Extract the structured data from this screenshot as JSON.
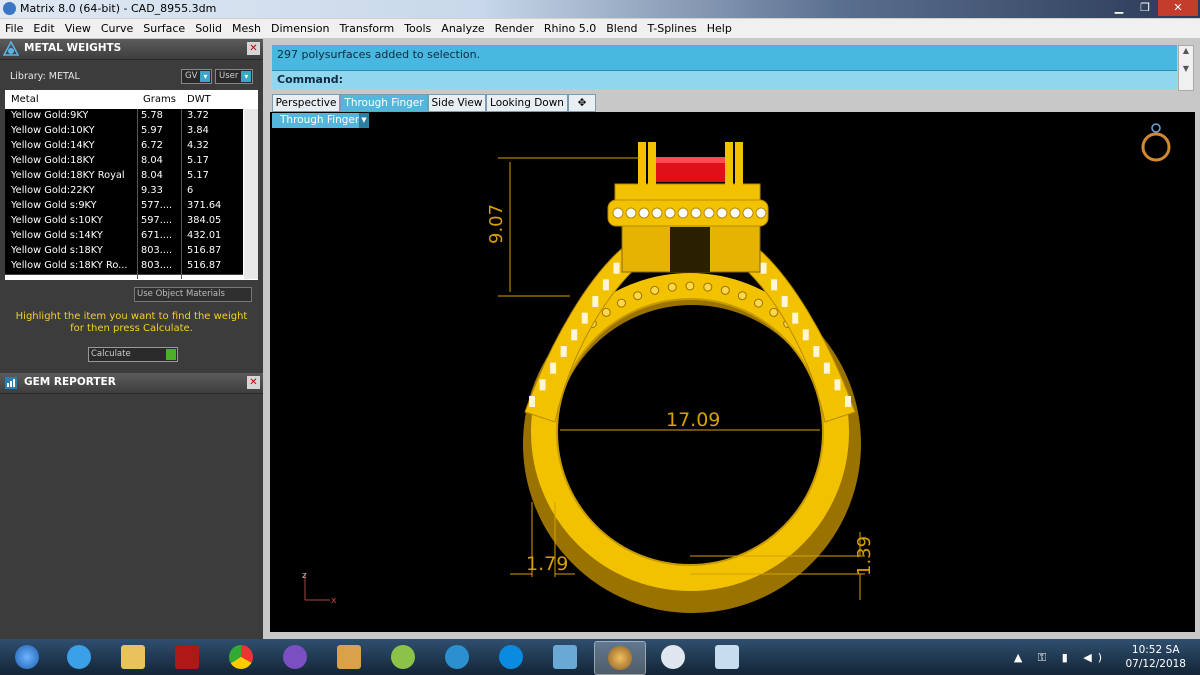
{
  "window": {
    "title": "Matrix 8.0 (64-bit) - CAD_8955.3dm",
    "min_glyph": "▁",
    "max_glyph": "❐",
    "close_glyph": "✕"
  },
  "menu": [
    "File",
    "Edit",
    "View",
    "Curve",
    "Surface",
    "Solid",
    "Mesh",
    "Dimension",
    "Transform",
    "Tools",
    "Analyze",
    "Render",
    "Rhino 5.0",
    "Blend",
    "T-Splines",
    "Help"
  ],
  "metal_weights": {
    "title": "METAL WEIGHTS",
    "library_label": "Library: METAL",
    "gv_label": "GV",
    "user_label": "User",
    "columns": [
      "Metal",
      "Grams",
      "DWT"
    ],
    "rows": [
      [
        "Yellow Gold:9KY",
        "5.78",
        "3.72"
      ],
      [
        "Yellow Gold:10KY",
        "5.97",
        "3.84"
      ],
      [
        "Yellow Gold:14KY",
        "6.72",
        "4.32"
      ],
      [
        "Yellow Gold:18KY",
        "8.04",
        "5.17"
      ],
      [
        "Yellow Gold:18KY Royal",
        "8.04",
        "5.17"
      ],
      [
        "Yellow Gold:22KY",
        "9.33",
        "6"
      ],
      [
        "Yellow Gold s:9KY",
        "577....",
        "371.64"
      ],
      [
        "Yellow Gold s:10KY",
        "597....",
        "384.05"
      ],
      [
        "Yellow Gold s:14KY",
        "671....",
        "432.01"
      ],
      [
        "Yellow Gold s:18KY",
        "803....",
        "516.87"
      ],
      [
        "Yellow Gold s:18KY Ro...",
        "803....",
        "516.87"
      ]
    ],
    "use_object_materials": "Use Object Materials",
    "hint": "Highlight the item you want to find the weight for then press Calculate.",
    "calculate_label": "Calculate"
  },
  "gem_reporter": {
    "title": "GEM REPORTER"
  },
  "command": {
    "history": "297 polysurfaces added to selection.",
    "prompt": "Command:"
  },
  "tabs": [
    "Perspective",
    "Through Finger",
    "Side View",
    "Looking Down",
    "✥"
  ],
  "active_tab": "Through Finger",
  "viewport": {
    "label": "Through Finger",
    "dimensions": {
      "height": "9.07",
      "inner_diameter": "17.09",
      "shank_width": "1.79",
      "shank_thickness": "1.39"
    },
    "axis_z": "z",
    "axis_x": "x",
    "colors": {
      "gold": "#f2c200",
      "gold_dark": "#b88a00",
      "stone": "#e0101a",
      "dim": "#d8a000"
    }
  },
  "taskbar": {
    "time": "10:52 SA",
    "date": "07/12/2018",
    "tray_icons": "▲ ⚿ ▮ ◀)"
  }
}
